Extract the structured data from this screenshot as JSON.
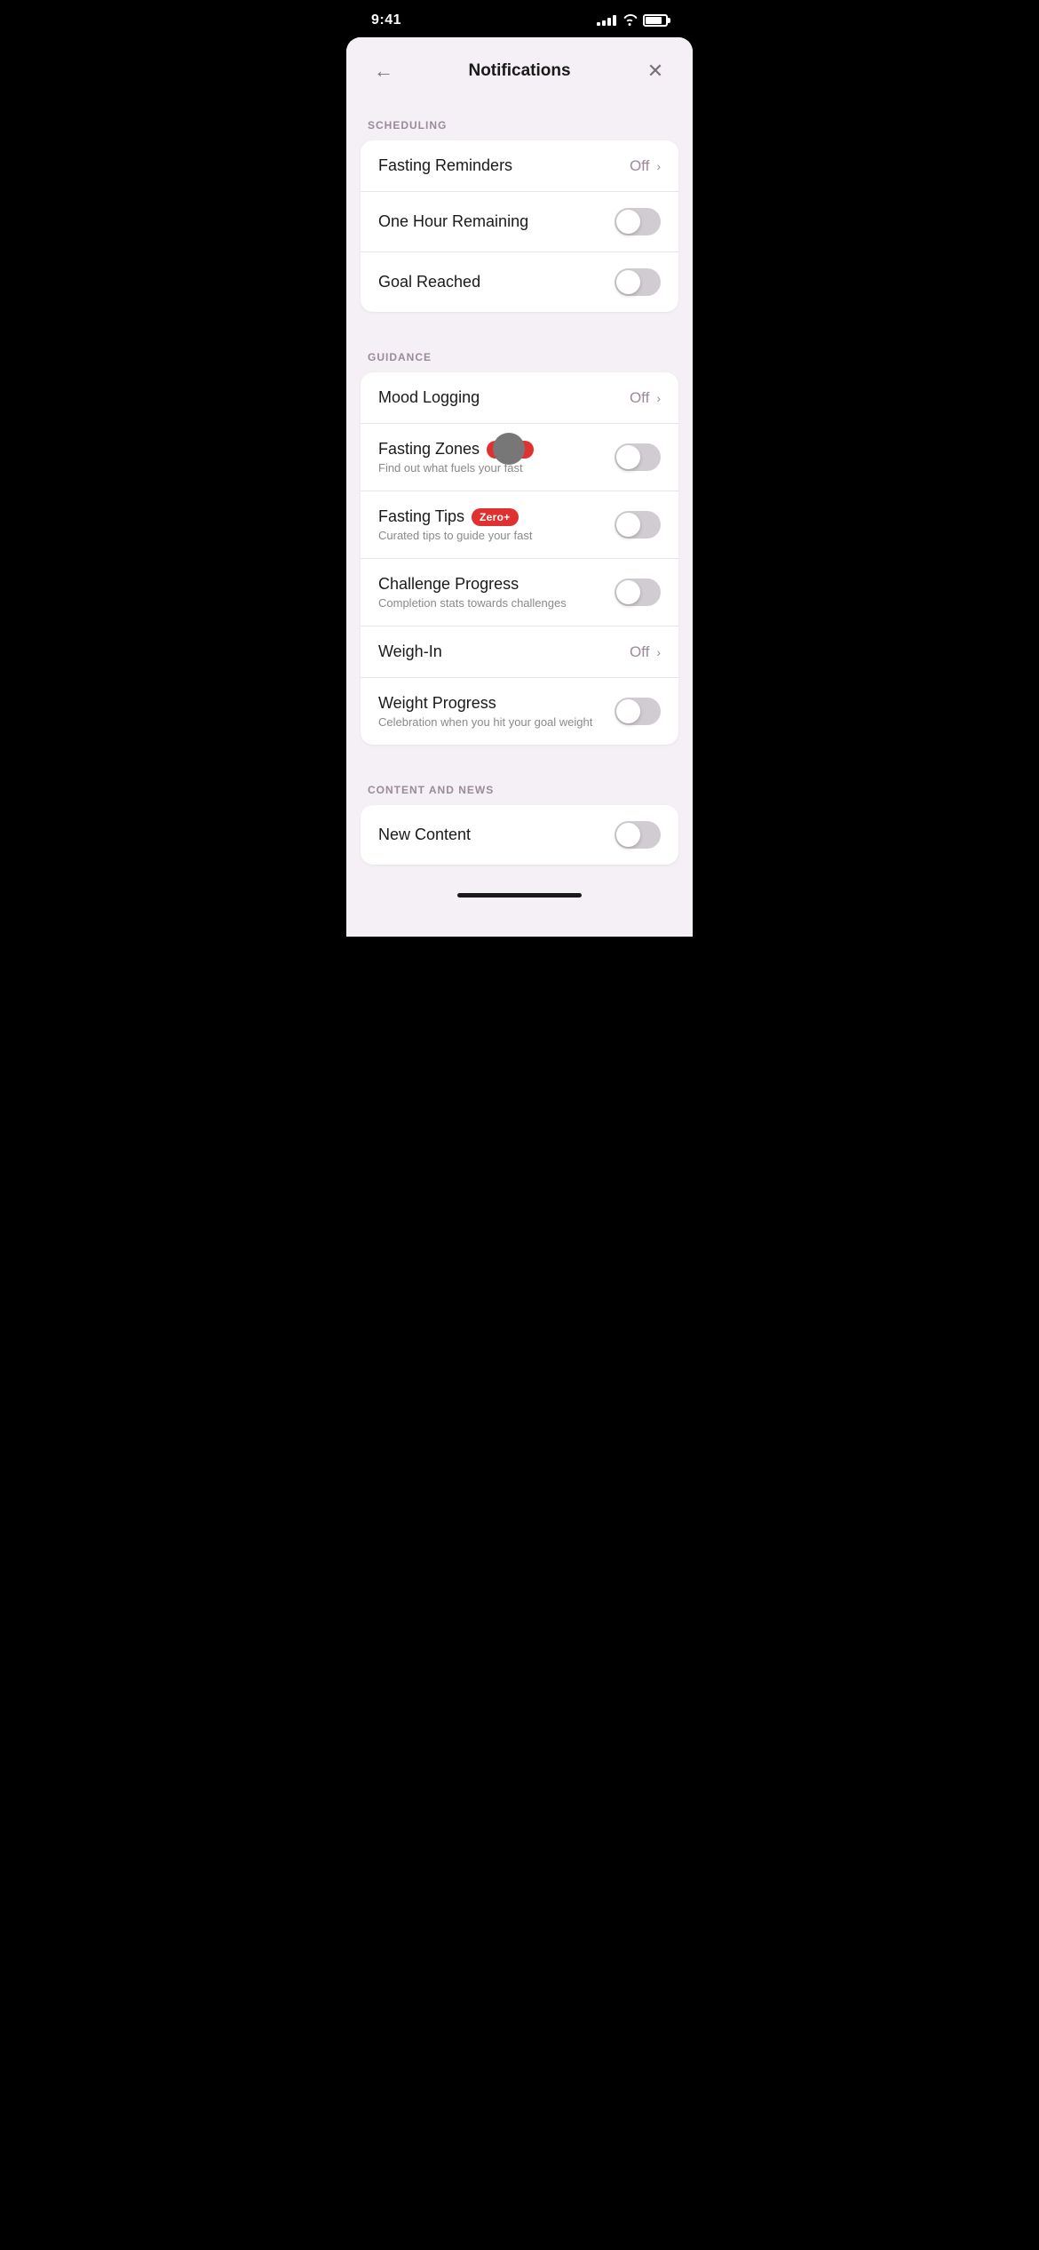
{
  "statusBar": {
    "time": "9:41",
    "signal": [
      3,
      5,
      7,
      10
    ],
    "batteryPercent": 75
  },
  "header": {
    "backLabel": "←",
    "closeLabel": "✕",
    "title": "Notifications"
  },
  "sections": [
    {
      "id": "scheduling",
      "label": "SCHEDULING",
      "rows": [
        {
          "id": "fasting-reminders",
          "title": "Fasting Reminders",
          "subtitle": null,
          "type": "link",
          "value": "Off",
          "toggled": null,
          "badge": null,
          "showTooltip": false
        },
        {
          "id": "one-hour-remaining",
          "title": "One Hour Remaining",
          "subtitle": null,
          "type": "toggle",
          "value": null,
          "toggled": false,
          "badge": null,
          "showTooltip": false
        },
        {
          "id": "goal-reached",
          "title": "Goal Reached",
          "subtitle": null,
          "type": "toggle",
          "value": null,
          "toggled": false,
          "badge": null,
          "showTooltip": false
        }
      ]
    },
    {
      "id": "guidance",
      "label": "GUIDANCE",
      "rows": [
        {
          "id": "mood-logging",
          "title": "Mood Logging",
          "subtitle": null,
          "type": "link",
          "value": "Off",
          "toggled": null,
          "badge": null,
          "showTooltip": false
        },
        {
          "id": "fasting-zones",
          "title": "Fasting Zones",
          "subtitle": "Find out what fuels your fast",
          "type": "toggle",
          "value": null,
          "toggled": false,
          "badge": "Zero+",
          "showTooltip": true
        },
        {
          "id": "fasting-tips",
          "title": "Fasting Tips",
          "subtitle": "Curated tips to guide your fast",
          "type": "toggle",
          "value": null,
          "toggled": false,
          "badge": "Zero+",
          "showTooltip": false
        },
        {
          "id": "challenge-progress",
          "title": "Challenge Progress",
          "subtitle": "Completion stats towards challenges",
          "type": "toggle",
          "value": null,
          "toggled": false,
          "badge": null,
          "showTooltip": false
        },
        {
          "id": "weigh-in",
          "title": "Weigh-In",
          "subtitle": null,
          "type": "link",
          "value": "Off",
          "toggled": null,
          "badge": null,
          "showTooltip": false
        },
        {
          "id": "weight-progress",
          "title": "Weight Progress",
          "subtitle": "Celebration when you hit your goal weight",
          "type": "toggle",
          "value": null,
          "toggled": false,
          "badge": null,
          "showTooltip": false
        }
      ]
    },
    {
      "id": "content-and-news",
      "label": "CONTENT AND NEWS",
      "rows": [
        {
          "id": "new-content",
          "title": "New Content",
          "subtitle": null,
          "type": "toggle",
          "value": null,
          "toggled": false,
          "badge": null,
          "showTooltip": false
        }
      ]
    }
  ]
}
